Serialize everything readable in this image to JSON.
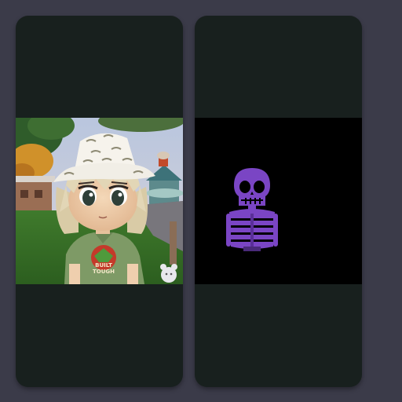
{
  "cards": [
    {
      "media": {
        "kind": "image",
        "subject": "anime-avatar-in-bucket-hat",
        "shirt_text_line1": "BUILT",
        "shirt_text_line2": "TOUGH"
      }
    },
    {
      "media": {
        "kind": "image",
        "subject": "purple-skeleton"
      }
    }
  ],
  "colors": {
    "page_background": "#3b3b49",
    "card_background": "#18201e",
    "skeleton_purple": "#7a45c4",
    "media_dark_background": "#000000"
  }
}
